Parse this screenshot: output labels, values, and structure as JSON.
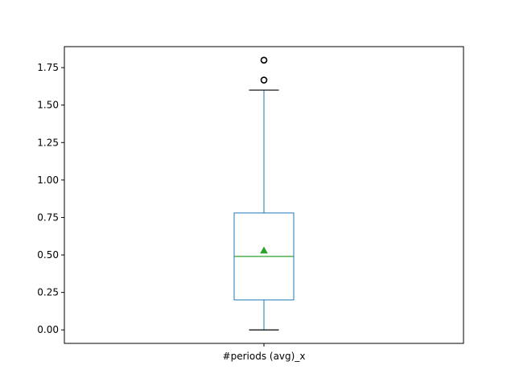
{
  "chart_data": {
    "type": "box",
    "title": "",
    "xlabel": "",
    "ylabel": "",
    "categories": [
      "#periods (avg)_x"
    ],
    "ylim": [
      -0.09,
      1.89
    ],
    "yticks": [
      0.0,
      0.25,
      0.5,
      0.75,
      1.0,
      1.25,
      1.5,
      1.75
    ],
    "ytick_labels": [
      "0.00",
      "0.25",
      "0.50",
      "0.75",
      "1.00",
      "1.25",
      "1.50",
      "1.75"
    ],
    "grid": false,
    "boxes": [
      {
        "name": "#periods (avg)_x",
        "whisker_low": 0.0,
        "q1": 0.2,
        "median": 0.49,
        "q3": 0.78,
        "whisker_high": 1.6,
        "mean": 0.53,
        "outliers": [
          1.667,
          1.8
        ]
      }
    ],
    "colors": {
      "box": "#1f77b4",
      "median": "#2ca02c",
      "mean_marker": "#2ca02c",
      "whisker_cap": "#000000",
      "outlier_edge": "#000000"
    }
  }
}
